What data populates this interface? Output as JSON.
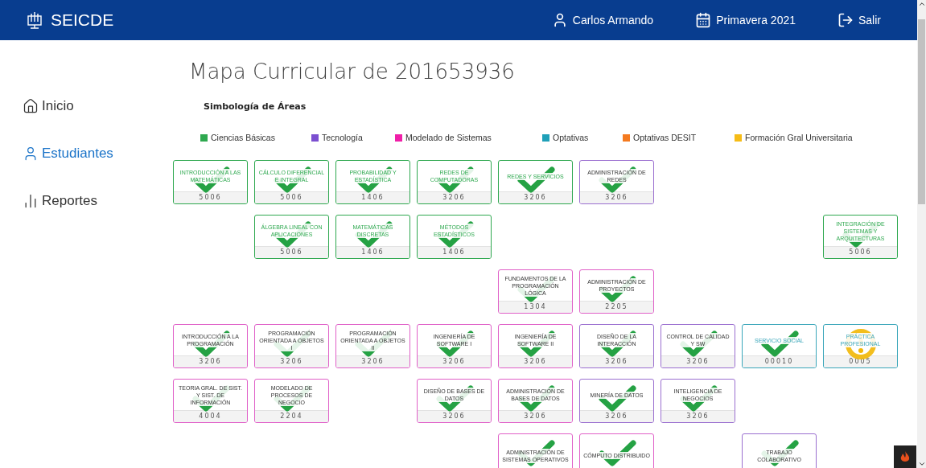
{
  "header": {
    "brand": "SEICDE",
    "user": "Carlos Armando",
    "term": "Primavera 2021",
    "logout": "Salir"
  },
  "sidebar": {
    "items": [
      {
        "label": "Inicio",
        "selected": false
      },
      {
        "label": "Estudiantes",
        "selected": true
      },
      {
        "label": "Reportes",
        "selected": false
      }
    ]
  },
  "page": {
    "title": "Mapa Curricular de 201653936"
  },
  "legend": {
    "title": "Simbología de Áreas",
    "items": [
      {
        "label": "Ciencias Básicas",
        "color": "#2ea84f"
      },
      {
        "label": "Tecnología",
        "color": "#7b4fd0"
      },
      {
        "label": "Modelado de Sistemas",
        "color": "#f01fa8"
      },
      {
        "label": "Optativas",
        "color": "#1fa0b8"
      },
      {
        "label": "Optativas DESIT",
        "color": "#f47a20"
      },
      {
        "label": "Formación Gral Universitaria",
        "color": "#f6bc16"
      }
    ]
  },
  "map": {
    "rows": [
      [
        {
          "kind": "course",
          "title": "INTRODUCCIÓN A LAS MATEMÁTICAS",
          "credits": "5006",
          "color": "#2ea84f",
          "tinted_title": true,
          "passed": true
        },
        {
          "kind": "course",
          "title": "CÁLCULO DIFERENCIAL E INTEGRAL",
          "credits": "5006",
          "color": "#2ea84f",
          "tinted_title": true,
          "passed": true
        },
        {
          "kind": "course",
          "title": "PROBABILIDAD Y ESTADÍSTICA",
          "credits": "1406",
          "color": "#2ea84f",
          "tinted_title": true,
          "passed": true
        },
        {
          "kind": "course",
          "title": "REDES DE COMPUTADORAS",
          "credits": "3206",
          "color": "#2ea84f",
          "tinted_title": true,
          "passed": true
        },
        {
          "kind": "course",
          "title": "REDES Y SERVICIOS",
          "credits": "3206",
          "color": "#2ea84f",
          "tinted_title": true,
          "passed": true
        },
        {
          "kind": "course",
          "title": "ADMINISTRACIÓN DE REDES",
          "credits": "3206",
          "color": "#9b6fd0",
          "tinted_title": false,
          "passed": true
        }
      ],
      [
        {
          "kind": "empty"
        },
        {
          "kind": "course",
          "title": "ÁLGEBRA LINEAL CON APLICACIONES",
          "credits": "5006",
          "color": "#2ea84f",
          "tinted_title": true,
          "passed": true
        },
        {
          "kind": "course",
          "title": "MATEMÁTICAS DISCRETAS",
          "credits": "1406",
          "color": "#2ea84f",
          "tinted_title": true,
          "passed": true
        },
        {
          "kind": "course",
          "title": "MÉTODOS ESTADÍSTICOS",
          "credits": "1406",
          "color": "#2ea84f",
          "tinted_title": true,
          "passed": true
        },
        {
          "kind": "empty"
        },
        {
          "kind": "empty"
        },
        {
          "kind": "empty"
        },
        {
          "kind": "empty"
        },
        {
          "kind": "course",
          "title": "INTEGRACIÓN DE SISTEMAS Y ARQUITECTURAS",
          "credits": "5006",
          "color": "#2ea84f",
          "tinted_title": true,
          "passed": true
        }
      ],
      [
        {
          "kind": "empty"
        },
        {
          "kind": "empty"
        },
        {
          "kind": "empty"
        },
        {
          "kind": "empty"
        },
        {
          "kind": "course",
          "title": "FUNDAMENTOS DE LA PROGRAMACIÓN LÓGICA",
          "credits": "1304",
          "color": "#e060c8",
          "tinted_title": false,
          "passed": true
        },
        {
          "kind": "course",
          "title": "ADMINISTRACIÓN DE PROYECTOS",
          "credits": "2205",
          "color": "#e060c8",
          "tinted_title": false,
          "passed": true
        }
      ],
      [
        {
          "kind": "course",
          "title": "INTRODUCCIÓN A LA PROGRAMACIÓN",
          "credits": "3206",
          "color": "#e060c8",
          "tinted_title": false,
          "passed": true
        },
        {
          "kind": "course",
          "title": "PROGRAMACIÓN ORIENTADA A OBJETOS I",
          "credits": "3206",
          "color": "#e060c8",
          "tinted_title": false,
          "passed": true
        },
        {
          "kind": "course",
          "title": "PROGRAMACIÓN ORIENTADA A OBJETOS II",
          "credits": "3206",
          "color": "#e060c8",
          "tinted_title": false,
          "passed": true
        },
        {
          "kind": "course",
          "title": "INGENIERÍA DE SOFTWARE I",
          "credits": "3206",
          "color": "#e060c8",
          "tinted_title": false,
          "passed": true
        },
        {
          "kind": "course",
          "title": "INGENIERÍA DE SOFTWARE II",
          "credits": "3206",
          "color": "#e060c8",
          "tinted_title": false,
          "passed": true
        },
        {
          "kind": "course",
          "title": "DISEÑO DE LA INTERACCIÓN",
          "credits": "3206",
          "color": "#9b6fd0",
          "tinted_title": false,
          "passed": true
        },
        {
          "kind": "course",
          "title": "CONTROL DE CALIDAD Y SW",
          "credits": "3206",
          "color": "#9b6fd0",
          "tinted_title": false,
          "passed": true
        },
        {
          "kind": "course",
          "title": "SERVICIO SOCIAL",
          "credits": "00010",
          "color": "#3aa6ba",
          "tinted_title": true,
          "passed": true
        },
        {
          "kind": "course",
          "title": "PRÁCTICA PROFESIONAL",
          "credits": "0005",
          "color": "#3aa6ba",
          "tinted_title": true,
          "passed": false
        }
      ],
      [
        {
          "kind": "course",
          "title": "TEORIA GRAL. DE SIST. Y SIST. DE INFORMACIÓN",
          "credits": "4004",
          "color": "#e060c8",
          "tinted_title": false,
          "passed": true
        },
        {
          "kind": "course",
          "title": "MODELADO DE PROCESOS DE NEGOCIO",
          "credits": "2204",
          "color": "#e060c8",
          "tinted_title": false,
          "passed": true
        },
        {
          "kind": "empty"
        },
        {
          "kind": "course",
          "title": "DISEÑO DE BASES DE DATOS",
          "credits": "3206",
          "color": "#e060c8",
          "tinted_title": false,
          "passed": true
        },
        {
          "kind": "course",
          "title": "ADMINISTRACIÓN DE BASES DE DATOS",
          "credits": "3206",
          "color": "#e060c8",
          "tinted_title": false,
          "passed": true
        },
        {
          "kind": "course",
          "title": "MINERÍA DE DATOS",
          "credits": "3206",
          "color": "#9b6fd0",
          "tinted_title": false,
          "passed": true
        },
        {
          "kind": "course",
          "title": "INTELIGENCIA DE NEGOCIOS",
          "credits": "3206",
          "color": "#9b6fd0",
          "tinted_title": false,
          "passed": true
        }
      ],
      [
        {
          "kind": "empty"
        },
        {
          "kind": "empty"
        },
        {
          "kind": "empty"
        },
        {
          "kind": "empty"
        },
        {
          "kind": "course",
          "title": "ADMINISTRACIÓN DE SISTEMAS OPERATIVOS",
          "color": "#e060c8",
          "tinted_title": false,
          "passed": true
        },
        {
          "kind": "course",
          "title": "CÓMPUTO DISTRIBUIDO",
          "color": "#e060c8",
          "tinted_title": false,
          "passed": true
        },
        {
          "kind": "empty"
        },
        {
          "kind": "course",
          "title": "TRABAJO COLABORATIVO",
          "color": "#9b6fd0",
          "tinted_title": false,
          "passed": true
        }
      ]
    ]
  }
}
